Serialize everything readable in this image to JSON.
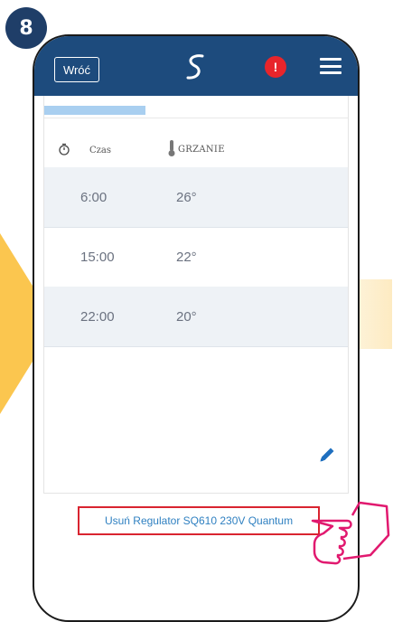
{
  "step": "8",
  "header": {
    "back_label": "Wróć",
    "alert_label": "!"
  },
  "schedule": {
    "progress_fraction": 0.33,
    "col_time": "Czas",
    "col_mode": "GRZANIE",
    "rows": [
      {
        "time": "6:00",
        "temp": "26°"
      },
      {
        "time": "15:00",
        "temp": "22°"
      },
      {
        "time": "22:00",
        "temp": "20°"
      }
    ]
  },
  "remove_link": "Usuń Regulator SQ610 230V Quantum",
  "colors": {
    "topbar": "#1d4b7d",
    "accent_arrow": "#fbc64f",
    "highlight": "#d92430",
    "hand": "#e1196f",
    "link": "#2f80c1"
  }
}
